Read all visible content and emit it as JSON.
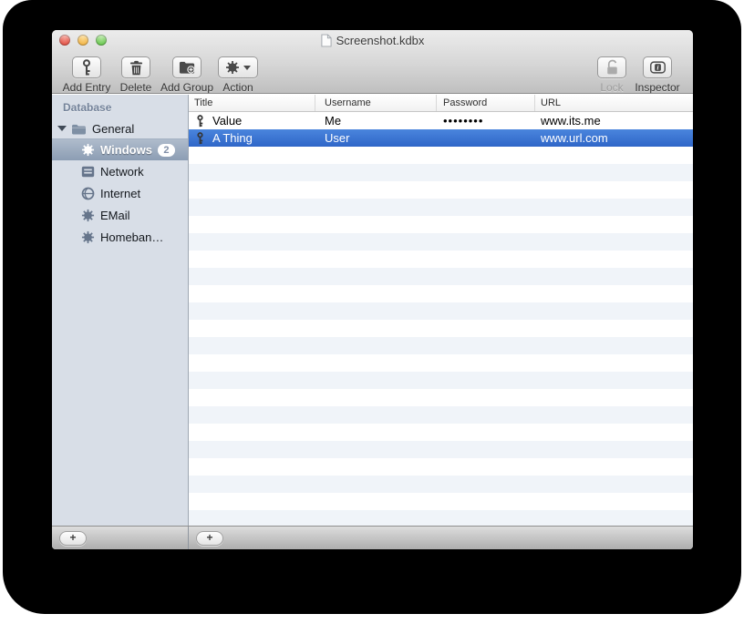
{
  "window": {
    "title": "Screenshot.kdbx"
  },
  "toolbar": {
    "left": [
      {
        "label": "Add Entry",
        "icon": "key-icon"
      },
      {
        "label": "Delete",
        "icon": "trash-icon"
      },
      {
        "label": "Add Group",
        "icon": "folder-plus-icon"
      },
      {
        "label": "Action",
        "icon": "gear-dropdown-icon"
      }
    ],
    "right": [
      {
        "label": "Lock",
        "icon": "lock-open-icon",
        "disabled": true
      },
      {
        "label": "Inspector",
        "icon": "inspector-icon",
        "disabled": false
      }
    ]
  },
  "sidebar": {
    "header": "Database",
    "root": {
      "label": "General",
      "icon": "folder-icon",
      "expanded": true
    },
    "items": [
      {
        "label": "Windows",
        "icon": "gear-icon",
        "badge": "2",
        "selected": true
      },
      {
        "label": "Network",
        "icon": "network-icon",
        "selected": false
      },
      {
        "label": "Internet",
        "icon": "globe-icon",
        "selected": false
      },
      {
        "label": "EMail",
        "icon": "gear-icon",
        "selected": false
      },
      {
        "label": "Homeban…",
        "icon": "gear-icon",
        "selected": false
      }
    ],
    "add_button_label": "+"
  },
  "table": {
    "columns": [
      "Title",
      "Username",
      "Password",
      "URL"
    ],
    "entries": [
      {
        "title": "Value",
        "username": "Me",
        "password": "••••••••",
        "url": "www.its.me",
        "selected": false,
        "icon": "key-icon"
      },
      {
        "title": "A Thing",
        "username": "User",
        "password": "",
        "url": "www.url.com",
        "selected": true,
        "icon": "key-icon"
      }
    ],
    "empty_row_count": 22,
    "add_button_label": "+"
  },
  "colors": {
    "selection_blue": "#3b79db",
    "sidebar_background": "#d8dee7",
    "row_stripe": "#f0f4f9",
    "traffic_red": "#e2564a",
    "traffic_yellow": "#f2b64b",
    "traffic_green": "#6cc853"
  }
}
